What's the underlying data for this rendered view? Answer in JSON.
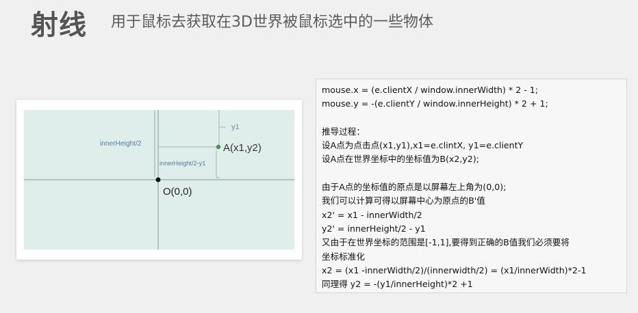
{
  "header": {
    "title": "射线",
    "subtitle": "用于鼠标去获取在3D世界被鼠标选中的一些物体"
  },
  "diagram": {
    "labels": {
      "inner_height_half": "innerHeight/2",
      "inner_height_half_minus_y1": "innerHeight/2-y1",
      "y1": "y1",
      "point_a": "A(x1,y2)",
      "origin": "O(0,0)"
    },
    "colors": {
      "background": "#dfeeea",
      "axis": "#90a8a4",
      "label_blue": "#5a78a0",
      "point_green": "#4f8c5b",
      "origin_black": "#111111"
    }
  },
  "code_panel": {
    "lines": [
      "mouse.x = (e.clientX / window.innerWidth) * 2 - 1;",
      "mouse.y = -(e.clientY / window.innerHeight) * 2 + 1;",
      "",
      "推导过程：",
      "设A点为点击点(x1,y1),x1=e.clintX, y1=e.clientY",
      "设A点在世界坐标中的坐标值为B(x2,y2);",
      "",
      "由于A点的坐标值的原点是以屏幕左上角为(0,0);",
      "我们可以计算可得以屏幕中心为原点的B'值",
      "x2' = x1 - innerWidth/2",
      "y2' = innerHeight/2 - y1",
      "又由于在世界坐标的范围是[-1,1],要得到正确的B值我们必须要将",
      "坐标标准化",
      "x2 = (x1 -innerWidth/2)/(innerwidth/2) = (x1/innerWidth)*2-1",
      "同理得 y2 = -(y1/innerHeight)*2 +1"
    ]
  }
}
